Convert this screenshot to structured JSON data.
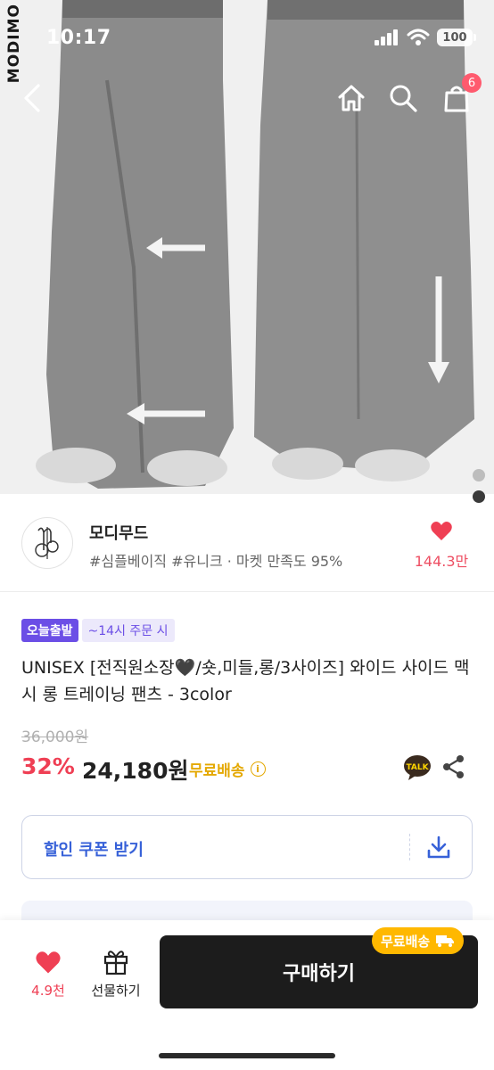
{
  "status": {
    "time": "10:17",
    "battery": "100"
  },
  "hero": {
    "watermark": "MODIMO"
  },
  "nav": {
    "cart_count": "6"
  },
  "seller": {
    "name": "모디무드",
    "tags": "#심플베이직 #유니크 · 마켓 만족도 95%",
    "likes": "144.3만"
  },
  "product": {
    "badge_today": "오늘출발",
    "badge_cutoff": "~14시 주문 시",
    "title": "UNISEX [전직원소장🖤/숏,미들,롱/3사이즈]  와이드 사이드 맥시 롱 트레이닝 팬츠 - 3color",
    "original_price": "36,000원",
    "discount": "32%",
    "price": "24,180원",
    "shipping": "무료배송",
    "talk_label": "TALK"
  },
  "coupon": {
    "label": "할인 쿠폰 받기"
  },
  "bottom": {
    "likes": "4.9천",
    "gift_label": "선물하기",
    "buy_label": "구매하기",
    "buy_tag": "무료배송"
  },
  "colors": {
    "accent_red": "#ef3f54",
    "accent_purple": "#6b4ee6",
    "accent_blue": "#3761d8",
    "accent_yellow": "#ffb800",
    "buy_button": "#1c1c1c"
  }
}
